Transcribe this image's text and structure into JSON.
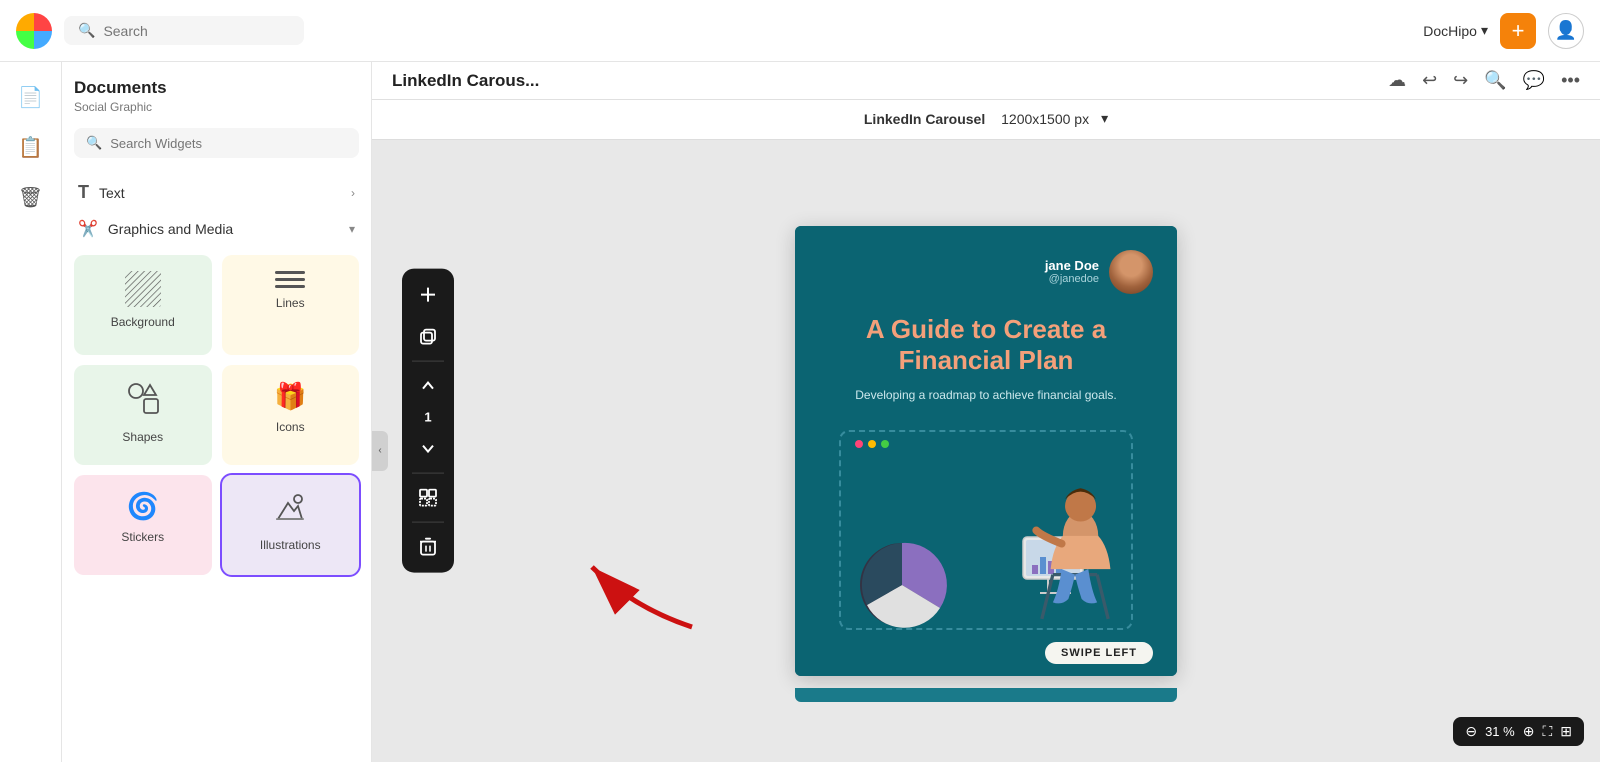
{
  "topbar": {
    "search_placeholder": "Search",
    "brand_name": "DocHipo",
    "brand_chevron": "▾",
    "plus_icon": "+",
    "user_icon": "👤"
  },
  "icon_sidebar": {
    "items": [
      {
        "name": "document-icon",
        "icon": "📄",
        "active": false
      },
      {
        "name": "text-doc-icon",
        "icon": "📋",
        "active": true
      },
      {
        "name": "trash-icon",
        "icon": "🗑",
        "active": false
      }
    ]
  },
  "widgets_panel": {
    "title": "Documents",
    "subtitle": "Social Graphic",
    "search_placeholder": "Search Widgets",
    "sections": [
      {
        "name": "Text",
        "icon": "T",
        "chevron": "›"
      },
      {
        "name": "Graphics and Media",
        "icon": "✂",
        "chevron": "▾"
      }
    ],
    "grid_items": [
      {
        "label": "Background",
        "icon": "bg",
        "theme": "green-light"
      },
      {
        "label": "Lines",
        "icon": "lines",
        "theme": "yellow-light"
      },
      {
        "label": "Shapes",
        "icon": "shapes",
        "theme": "green-light"
      },
      {
        "label": "Icons",
        "icon": "gift",
        "theme": "yellow-light"
      },
      {
        "label": "Stickers",
        "icon": "stickers",
        "theme": "pink-light"
      },
      {
        "label": "Illustrations",
        "icon": "illus",
        "theme": "purple-light",
        "highlighted": true
      }
    ]
  },
  "canvas_header": {
    "title": "LinkedIn Carous...",
    "doc_label": "LinkedIn Carousel",
    "doc_size": "1200x1500 px",
    "icons": [
      "cloud",
      "undo",
      "redo",
      "search",
      "chat",
      "more"
    ]
  },
  "design_card": {
    "profile_name": "jane Doe",
    "profile_handle": "@janedoe",
    "headline_line1": "A Guide to Create a",
    "headline_line2": "Financial Plan",
    "subtext": "Developing a roadmap to achieve financial goals.",
    "swipe_label": "SWIPE LEFT"
  },
  "vertical_toolbar": {
    "page_num": "1",
    "buttons": [
      "plus",
      "copy",
      "up",
      "down",
      "grid",
      "trash"
    ]
  },
  "zoom_bar": {
    "percent": "31 %",
    "minus_icon": "⊖",
    "plus_icon": "⊕",
    "expand_icon": "⛶",
    "grid_icon": "⊞"
  }
}
